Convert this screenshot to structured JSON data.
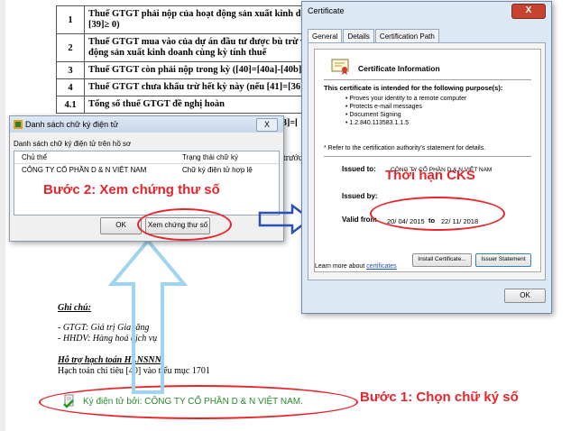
{
  "document": {
    "table_rows": [
      {
        "num": "1",
        "text": "Thuế GTGT phải nộp của hoạt động sản xuất kinh do - [39]≥ 0)"
      },
      {
        "num": "2",
        "text": "Thuế GTGT mua vào của dự án đầu tư được bù trừ v động sản xuất kinh doanh cùng kỳ tính thuế"
      },
      {
        "num": "3",
        "text": "Thuế GTGT còn phải nộp trong kỳ ([40]=[40a]-[40b])"
      },
      {
        "num": "4",
        "text": "Thuế GTGT chưa khấu trừ hết kỳ này (nếu [41]=[36]-"
      },
      {
        "num": "4.1",
        "text": "Tổng số thuế GTGT đề nghị hoàn"
      }
    ],
    "fragment_truoc": "trước",
    "fragment_formula": "3]=[",
    "notes": {
      "heading": "Ghi chú:",
      "gtgt": "- GTGT: Giá trị Gia tăng",
      "hhdv": "- HHDV: Hàng hoá dịch vụ",
      "support_heading": "Hỗ trợ hạch toán HLNSNN",
      "support_text": "Hạch toán chỉ tiêu [40] vào tiểu mục 1701"
    },
    "signature_text": "Ký điện tử bởi: CÔNG TY CỔ PHẦN D & N VIỆT NAM."
  },
  "signature_dialog": {
    "title": "Danh sách chữ ký điện tử",
    "close_label": "X",
    "caption": "Danh sách chữ ký điện tử trên hồ sơ",
    "columns": [
      "Chủ thể",
      "Trạng thái chữ ký"
    ],
    "rows": [
      {
        "subject": "CÔNG TY CỔ PHẦN D & N VIỆT NAM",
        "status": "Chữ ký điện tử hợp lệ"
      }
    ],
    "ok_label": "OK",
    "view_label": "Xem chứng thư số"
  },
  "certificate_dialog": {
    "title": "Certificate",
    "close_label": "X",
    "tabs": [
      "General",
      "Details",
      "Certification Path"
    ],
    "info_title": "Certificate Information",
    "purpose_heading": "This certificate is intended for the following purpose(s):",
    "purposes": [
      "Proves your identity to a remote computer",
      "Protects e-mail messages",
      "Document Signing",
      "1.2.840.113583.1.1.5"
    ],
    "refer_note": "* Refer to the certification authority's statement for details.",
    "issued_to_label": "Issued to:",
    "issued_to_value": "CÔNG TY CỔ PHẦN D & N VIỆT NAM",
    "issued_by_label": "Issued by:",
    "valid_from_label": "Valid from",
    "valid_from": "20/ 04/ 2015",
    "valid_to_word": "to",
    "valid_to": "22/ 11/ 2018",
    "install_button": "Install Certificate...",
    "issuer_button": "Issuer Statement",
    "learn_more_prefix": "Learn more about",
    "learn_more_link": "certificates",
    "ok_label": "OK"
  },
  "annotations": {
    "step2": "Bước 2: Xem chứng thư số",
    "step1": "Bước 1: Chọn chữ ký số",
    "cert_term": "Thời hạn CKS"
  },
  "colors": {
    "annotation_red": "#e8242b",
    "signature_green": "#2a8a2a",
    "arrow_blue": "#2d4fb8",
    "arrow_light": "#9fd3ee",
    "link_blue": "#1a56c4"
  }
}
